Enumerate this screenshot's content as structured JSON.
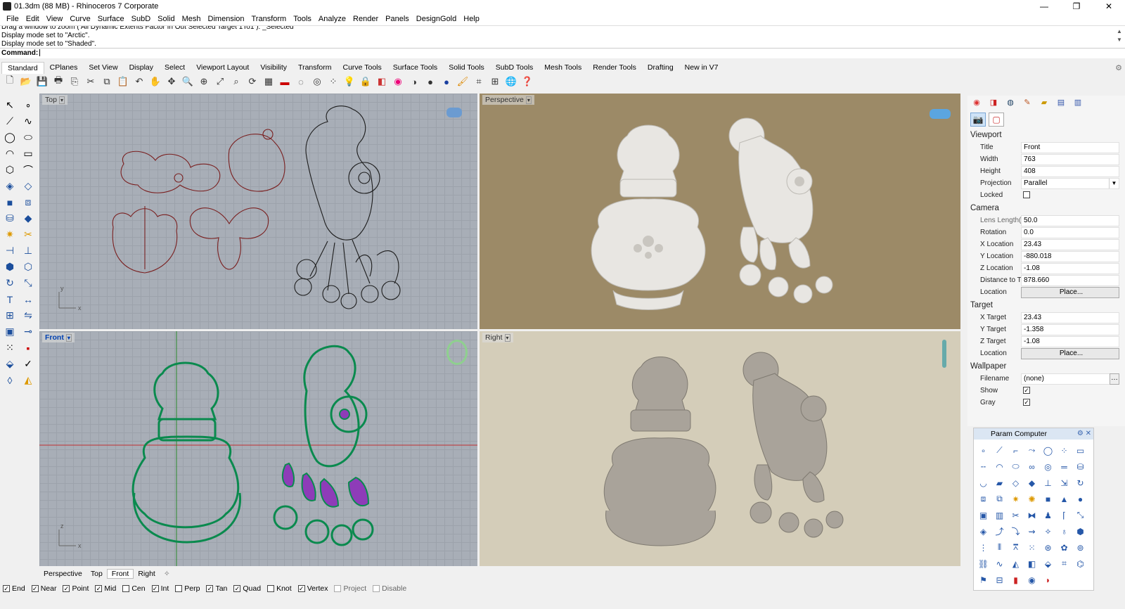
{
  "window": {
    "title": "01.3dm (88 MB) - Rhinoceros 7 Corporate",
    "controls": [
      "—",
      "❐",
      "✕"
    ]
  },
  "menu": [
    "File",
    "Edit",
    "View",
    "Curve",
    "Surface",
    "SubD",
    "Solid",
    "Mesh",
    "Dimension",
    "Transform",
    "Tools",
    "Analyze",
    "Render",
    "Panels",
    "DesignGold",
    "Help"
  ],
  "command_history": [
    "Drag a window to zoom ( All Dynamic Extents Factor In Out Selected Target 1To1 ): _Selected",
    "Display mode set to \"Arctic\".",
    "Display mode set to \"Shaded\"."
  ],
  "command_prompt": "Command:",
  "toolbar_tabs": [
    "Standard",
    "CPlanes",
    "Set View",
    "Display",
    "Select",
    "Viewport Layout",
    "Visibility",
    "Transform",
    "Curve Tools",
    "Surface Tools",
    "Solid Tools",
    "SubD Tools",
    "Mesh Tools",
    "Render Tools",
    "Drafting",
    "New in V7"
  ],
  "toolbar_icons": [
    "new-icon",
    "open-icon",
    "save-icon",
    "print-icon",
    "import-icon",
    "cut-icon",
    "copy-icon",
    "paste-icon",
    "undo-icon",
    "pan-icon",
    "move-icon",
    "zoom-icon",
    "zoom-window-icon",
    "zoom-extents-icon",
    "zoom-selected-icon",
    "rotate-view-icon",
    "grid-icon",
    "car-icon",
    "hide-icon",
    "show-icon",
    "points-icon",
    "light-icon",
    "lock-icon",
    "layer-icon",
    "color-wheel-icon",
    "render-icon",
    "shaded-sphere-icon",
    "rendered-sphere-icon",
    "paint-icon",
    "mesh-icon",
    "snap-icon",
    "globe-icon",
    "help-icon"
  ],
  "viewports": {
    "top": "Top",
    "perspective": "Perspective",
    "front": "Front",
    "right": "Right"
  },
  "viewport_tabs": [
    "Perspective",
    "Top",
    "Front",
    "Right"
  ],
  "osnaps": [
    {
      "label": "End",
      "checked": true
    },
    {
      "label": "Near",
      "checked": true
    },
    {
      "label": "Point",
      "checked": true
    },
    {
      "label": "Mid",
      "checked": true
    },
    {
      "label": "Cen",
      "checked": false
    },
    {
      "label": "Int",
      "checked": true
    },
    {
      "label": "Perp",
      "checked": false
    },
    {
      "label": "Tan",
      "checked": true
    },
    {
      "label": "Quad",
      "checked": true
    },
    {
      "label": "Knot",
      "checked": false
    },
    {
      "label": "Vertex",
      "checked": true
    },
    {
      "label": "Project",
      "checked": false
    },
    {
      "label": "Disable",
      "checked": false
    }
  ],
  "properties": {
    "viewport_section": "Viewport",
    "title_label": "Title",
    "title_value": "Front",
    "width_label": "Width",
    "width_value": "763",
    "height_label": "Height",
    "height_value": "408",
    "projection_label": "Projection",
    "projection_value": "Parallel",
    "locked_label": "Locked",
    "camera_section": "Camera",
    "lens_label": "Lens Length(m...",
    "lens_value": "50.0",
    "rotation_label": "Rotation",
    "rotation_value": "0.0",
    "xloc_label": "X Location",
    "xloc_value": "23.43",
    "yloc_label": "Y Location",
    "yloc_value": "-880.018",
    "zloc_label": "Z Location",
    "zloc_value": "-1.08",
    "dist_label": "Distance to Tar...",
    "dist_value": "878.660",
    "loc_label": "Location",
    "place_button": "Place...",
    "target_section": "Target",
    "xtar_label": "X Target",
    "xtar_value": "23.43",
    "ytar_label": "Y Target",
    "ytar_value": "-1.358",
    "ztar_label": "Z Target",
    "ztar_value": "-1.08",
    "tloc_label": "Location",
    "tplace_button": "Place...",
    "wallpaper_section": "Wallpaper",
    "filename_label": "Filename",
    "filename_value": "(none)",
    "show_label": "Show",
    "gray_label": "Gray"
  },
  "param_panel": {
    "title": "Param Computer"
  }
}
